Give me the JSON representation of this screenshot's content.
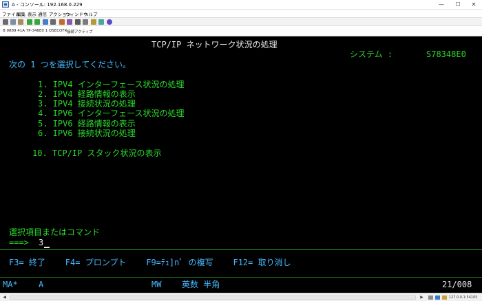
{
  "window": {
    "title": "A - コンソール: 192.168.0.229",
    "minimize": "—",
    "maximize": "☐",
    "close": "✕"
  },
  "menu": [
    "ファイル",
    "編集",
    "表示",
    "通信",
    "アクション",
    "ウィンドウ",
    "ヘルプ"
  ],
  "toolbar_icons": [
    "print-icon",
    "copy-icon",
    "paste-icon",
    "send-icon",
    "receive-icon",
    "display-icon",
    "keypad-icon",
    "macro-play-icon",
    "macro-record-icon",
    "disconnect-icon",
    "settings-icon",
    "lock-icon",
    "customize-icon",
    "help-icon"
  ],
  "status_strip": {
    "session_info": "B 9889 41A 7P-348E0 1 QSECOFR",
    "connection_status": "接続アクティブ"
  },
  "screen": {
    "title": "TCP/IP ネットワーク状況の処理",
    "system_label": "システム :",
    "system_name": "S78348E0",
    "instruction": "次の 1 つを選択してください。",
    "options": [
      "1. IPV4 インターフェース状況の処理",
      "2. IPV4 経路情報の表示",
      "3. IPV4 接続状況の処理",
      "4. IPV6 インターフェース状況の処理",
      "5. IPV6 経路情報の表示",
      "6. IPV6 接続状況の処理"
    ],
    "option_10": "10. TCP/IP スタック状況の表示",
    "command_label": "選択項目またはコマンド",
    "prompt": "===>",
    "command_value": "3",
    "function_keys": "F3= 終了    F4= プロンプト    F9=ﾃｭ]nﾟ の複写    F12= 取り消し"
  },
  "oia": {
    "ma": "MA*",
    "session": "A",
    "mw": "MW",
    "input_mode": "英数 半角",
    "cursor_pos": "21/008"
  },
  "bottom": {
    "ip": "127.0.0.1:54105"
  }
}
